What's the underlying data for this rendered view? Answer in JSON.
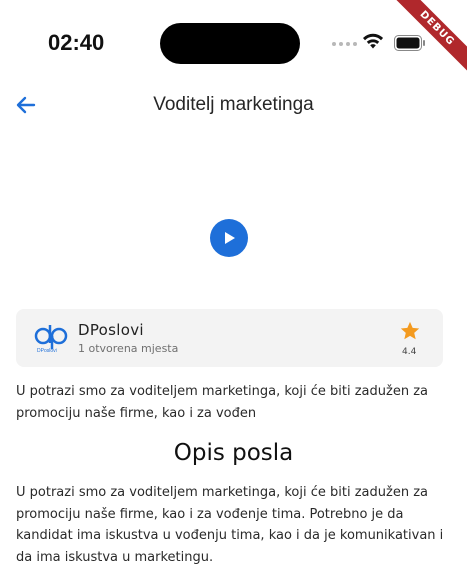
{
  "status_bar": {
    "time": "02:40"
  },
  "debug_banner": "DEBUG",
  "app_bar": {
    "title": "Voditelj marketinga"
  },
  "company": {
    "name": "DPoslovi",
    "logo_text": "DPoslovi",
    "open_positions": "1 otvorena mjesta",
    "rating": "4.4"
  },
  "job": {
    "short_description": "U potrazi smo za voditeljem marketinga, koji će biti zadužen za promociju naše firme, kao i za vođen",
    "section_title": "Opis posla",
    "full_description": "U potrazi smo za voditeljem marketinga, koji će biti zadužen za promociju naše firme, kao i za vođenje tima. Potrebno je da kandidat ima iskustva u vođenju tima, kao i da je komunikativan i da ima iskustva u marketingu."
  },
  "colors": {
    "accent": "#1e6fd9",
    "star": "#f39a1f",
    "card_bg": "#f3f3f3",
    "debug": "#b0282c"
  },
  "icons": {
    "back": "arrow-left-icon",
    "play": "play-icon",
    "star": "star-icon",
    "wifi": "wifi-icon",
    "battery": "battery-icon"
  }
}
